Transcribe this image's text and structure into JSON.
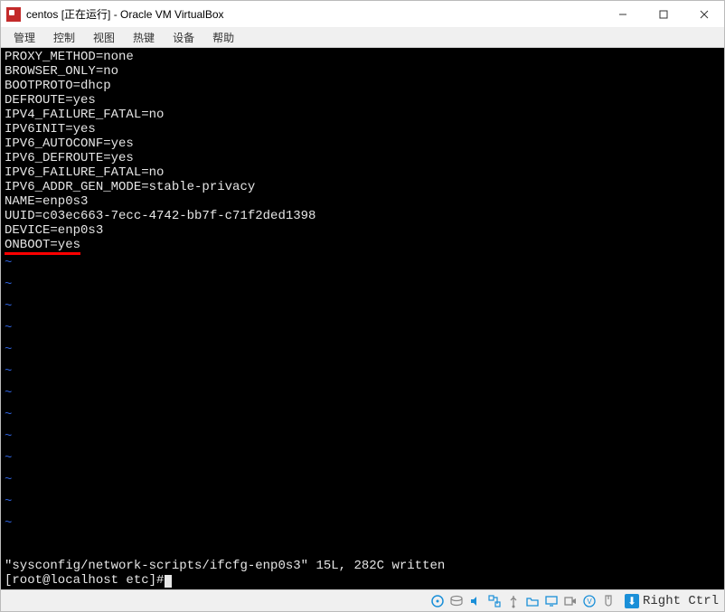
{
  "window": {
    "title": "centos [正在运行] - Oracle VM VirtualBox"
  },
  "menu": {
    "items": [
      "管理",
      "控制",
      "视图",
      "热键",
      "设备",
      "帮助"
    ]
  },
  "config_lines": [
    {
      "key": "PROXY_METHOD",
      "value": "none"
    },
    {
      "key": "BROWSER_ONLY",
      "value": "no"
    },
    {
      "key": "BOOTPROTO",
      "value": "dhcp"
    },
    {
      "key": "DEFROUTE",
      "value": "yes"
    },
    {
      "key": "IPV4_FAILURE_FATAL",
      "value": "no"
    },
    {
      "key": "IPV6INIT",
      "value": "yes"
    },
    {
      "key": "IPV6_AUTOCONF",
      "value": "yes"
    },
    {
      "key": "IPV6_DEFROUTE",
      "value": "yes"
    },
    {
      "key": "IPV6_FAILURE_FATAL",
      "value": "no"
    },
    {
      "key": "IPV6_ADDR_GEN_MODE",
      "value": "stable-privacy"
    },
    {
      "key": "NAME",
      "value": "enp0s3"
    },
    {
      "key": "UUID",
      "value": "c03ec663-7ecc-4742-bb7f-c71f2ded1398"
    },
    {
      "key": "DEVICE",
      "value": "enp0s3"
    },
    {
      "key": "ONBOOT",
      "value": "yes",
      "highlight": true
    }
  ],
  "vim": {
    "status_line": "\"sysconfig/network-scripts/ifcfg-enp0s3\" 15L, 282C written",
    "prompt": "[root@localhost etc]#"
  },
  "statusbar": {
    "hostkey": "Right Ctrl"
  }
}
